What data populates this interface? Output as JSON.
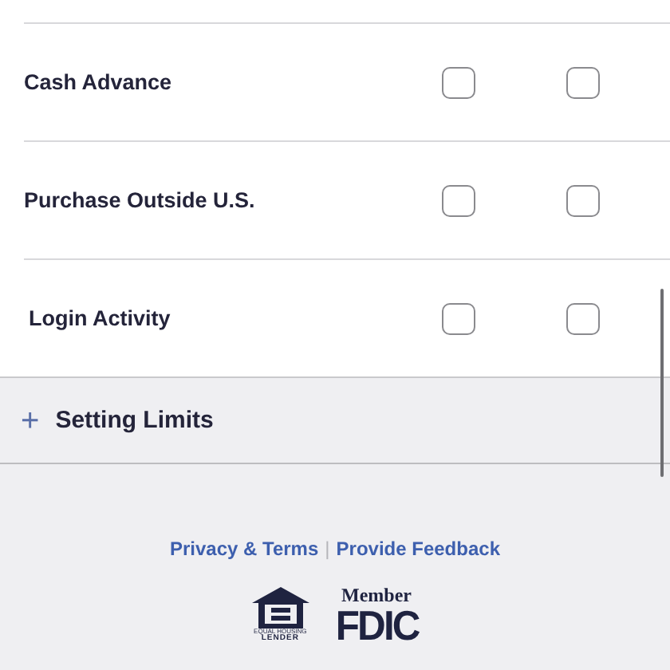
{
  "alert_rows": [
    {
      "label": "Cash Advance",
      "options": [
        {
          "checked": false
        },
        {
          "checked": false
        }
      ]
    },
    {
      "label": "Purchase Outside U.S.",
      "options": [
        {
          "checked": false
        },
        {
          "checked": false
        }
      ]
    },
    {
      "label": "Login Activity",
      "options": [
        {
          "checked": false
        },
        {
          "checked": false
        }
      ]
    }
  ],
  "section": {
    "icon": "+",
    "title": "Setting Limits",
    "expanded": false
  },
  "footer": {
    "links": [
      "Privacy & Terms",
      "Provide Feedback"
    ],
    "separator": "|",
    "housing_logo": {
      "line_1": "EQUAL HOUSING",
      "line_2": "LENDER"
    },
    "fdic_logo": {
      "top": "Member",
      "bottom": "FDIC"
    }
  }
}
